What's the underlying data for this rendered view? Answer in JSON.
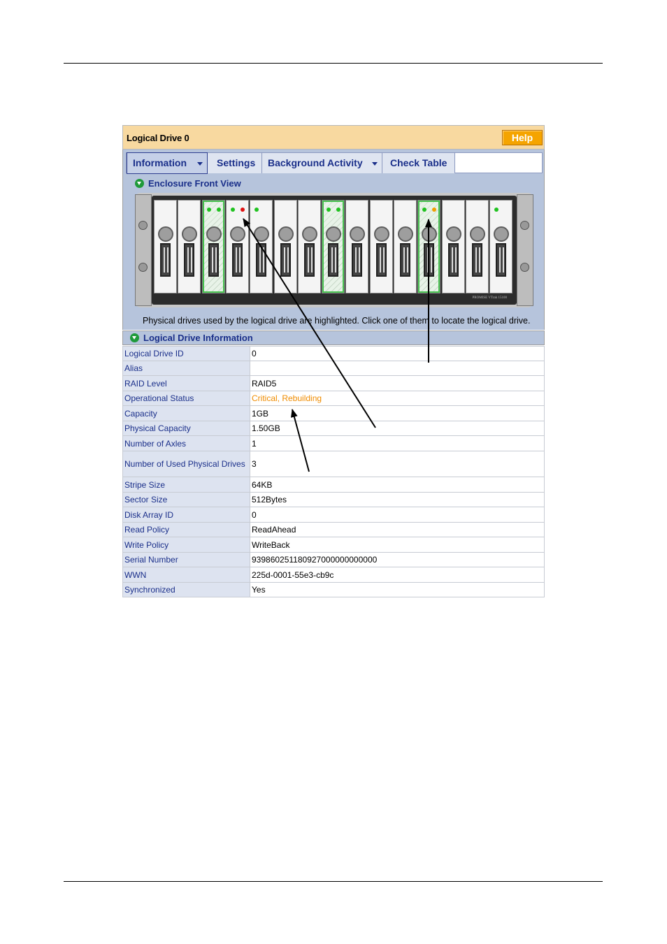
{
  "window": {
    "title": "Logical Drive 0",
    "help_label": "Help"
  },
  "tabs": [
    {
      "label": "Information",
      "has_menu": true,
      "active": true
    },
    {
      "label": "Settings",
      "has_menu": false,
      "active": false
    },
    {
      "label": "Background Activity",
      "has_menu": true,
      "active": false
    },
    {
      "label": "Check Table",
      "has_menu": false,
      "active": false
    }
  ],
  "enclosure_view": {
    "heading": "Enclosure Front View",
    "caption": "Physical drives used by the logical drive are highlighted. Click one of them to locate the logical drive.",
    "brand": "PROMISE   VTrak 15100",
    "colors": {
      "led_green": "#1fc21f",
      "led_red": "#e01010",
      "led_orange": "#f0a000",
      "highlight": "#47c24f"
    },
    "bays": [
      {
        "led1": "",
        "led2": "",
        "highlighted": false
      },
      {
        "led1": "",
        "led2": "",
        "highlighted": false
      },
      {
        "led1": "green",
        "led2": "green",
        "highlighted": true
      },
      {
        "led1": "green",
        "led2": "red",
        "highlighted": false
      },
      {
        "led1": "green",
        "led2": "",
        "highlighted": false
      },
      {
        "led1": "",
        "led2": "",
        "highlighted": false
      },
      {
        "led1": "",
        "led2": "",
        "highlighted": false
      },
      {
        "led1": "green",
        "led2": "green",
        "highlighted": true
      },
      {
        "led1": "",
        "led2": "",
        "highlighted": false
      },
      {
        "led1": "",
        "led2": "",
        "highlighted": false
      },
      {
        "led1": "",
        "led2": "",
        "highlighted": false
      },
      {
        "led1": "green",
        "led2": "orange",
        "highlighted": true
      },
      {
        "led1": "",
        "led2": "",
        "highlighted": false
      },
      {
        "led1": "",
        "led2": "",
        "highlighted": false
      },
      {
        "led1": "green",
        "led2": "",
        "highlighted": false
      }
    ]
  },
  "info": {
    "heading": "Logical Drive Information",
    "rows": [
      {
        "label": "Logical Drive ID",
        "value": "0"
      },
      {
        "label": "Alias",
        "value": ""
      },
      {
        "label": "RAID Level",
        "value": "RAID5"
      },
      {
        "label": "Operational Status",
        "value": "Critical, Rebuilding",
        "status_color": "#f08c00"
      },
      {
        "label": "Capacity",
        "value": "1GB"
      },
      {
        "label": "Physical Capacity",
        "value": "1.50GB"
      },
      {
        "label": "Number of Axles",
        "value": "1"
      },
      {
        "label": "Number of Used Physical Drives",
        "value": "3"
      },
      {
        "label": "Stripe Size",
        "value": "64KB"
      },
      {
        "label": "Sector Size",
        "value": "512Bytes"
      },
      {
        "label": "Disk Array ID",
        "value": "0"
      },
      {
        "label": "Read Policy",
        "value": "ReadAhead"
      },
      {
        "label": "Write Policy",
        "value": "WriteBack"
      },
      {
        "label": "Serial Number",
        "value": "939860251180927000000000000"
      },
      {
        "label": "WWN",
        "value": "225d-0001-55e3-cb9c"
      },
      {
        "label": "Synchronized",
        "value": "Yes"
      }
    ]
  }
}
